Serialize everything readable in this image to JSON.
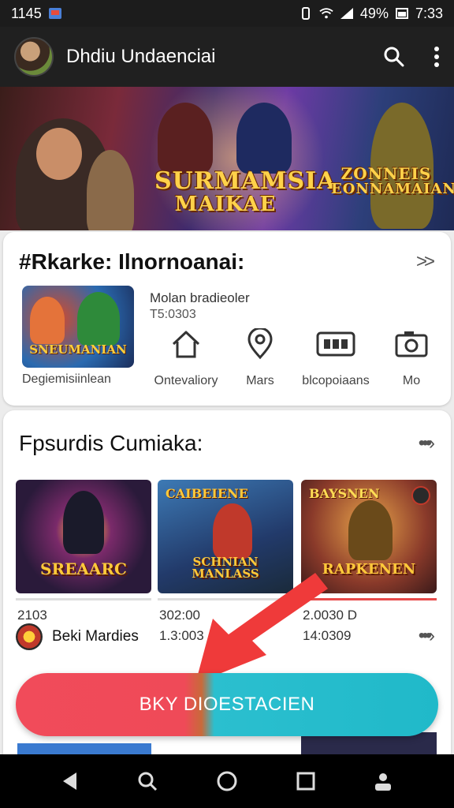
{
  "status_bar": {
    "time_left": "1145",
    "battery": "49%",
    "time_right": "7:33"
  },
  "app_bar": {
    "title": "Dhdiu Undaenciai",
    "search_icon": "search-icon",
    "menu_icon": "more-vert-icon"
  },
  "hero": {
    "logo_left_line1": "SURMAMSIA",
    "logo_left_line2": "MAIKAE",
    "logo_right_line1": "ZONNEIS",
    "logo_right_line2": "EONNAMAIAN"
  },
  "section1": {
    "title": "#Rkarke: Ilnornoanai:",
    "more_icon": "double-chevron-right-icon",
    "featured": {
      "thumb_logo": "SNEUMANIAN",
      "caption": "Degiemisiinlean",
      "title": "Molan bradieoler",
      "subtitle": "T5:0303"
    },
    "quick_links": [
      {
        "label": "Ontevaliory",
        "icon": "home-icon"
      },
      {
        "label": "Mars",
        "icon": "location-pin-icon"
      },
      {
        "label": "blcopoiaans",
        "icon": "ticket-icon"
      },
      {
        "label": "Mo",
        "icon": "camera-icon"
      }
    ]
  },
  "section2": {
    "title": "Fpsurdis Cumiaka:",
    "more_icon": "more-horiz-chevron-icon",
    "games": [
      {
        "logo": "SREAARC",
        "top_logo": "",
        "value": "2103",
        "accent": "#c53f2e"
      },
      {
        "logo": "SCHNIAN MANLASS",
        "top_logo": "CAIBEIENE",
        "value": "302:00",
        "value2": "1.3:003",
        "accent": "#2c6e9e"
      },
      {
        "logo": "RAPKENEN",
        "top_logo": "BAYSNEN",
        "value": "2.0030 D",
        "value2": "14:0309",
        "accent": "#d6a33a"
      }
    ],
    "developer": {
      "name": "Beki Mardies",
      "icon": "developer-badge-icon"
    },
    "row_more_icon": "more-horiz-chevron-icon"
  },
  "cta": {
    "label": "BKY DIOESTACIEN",
    "color_left": "#f14b5a",
    "color_right": "#20b9c9"
  },
  "nav_bar": {
    "icons": [
      "back-icon",
      "search-icon",
      "home-icon",
      "recents-icon",
      "account-icon"
    ]
  }
}
